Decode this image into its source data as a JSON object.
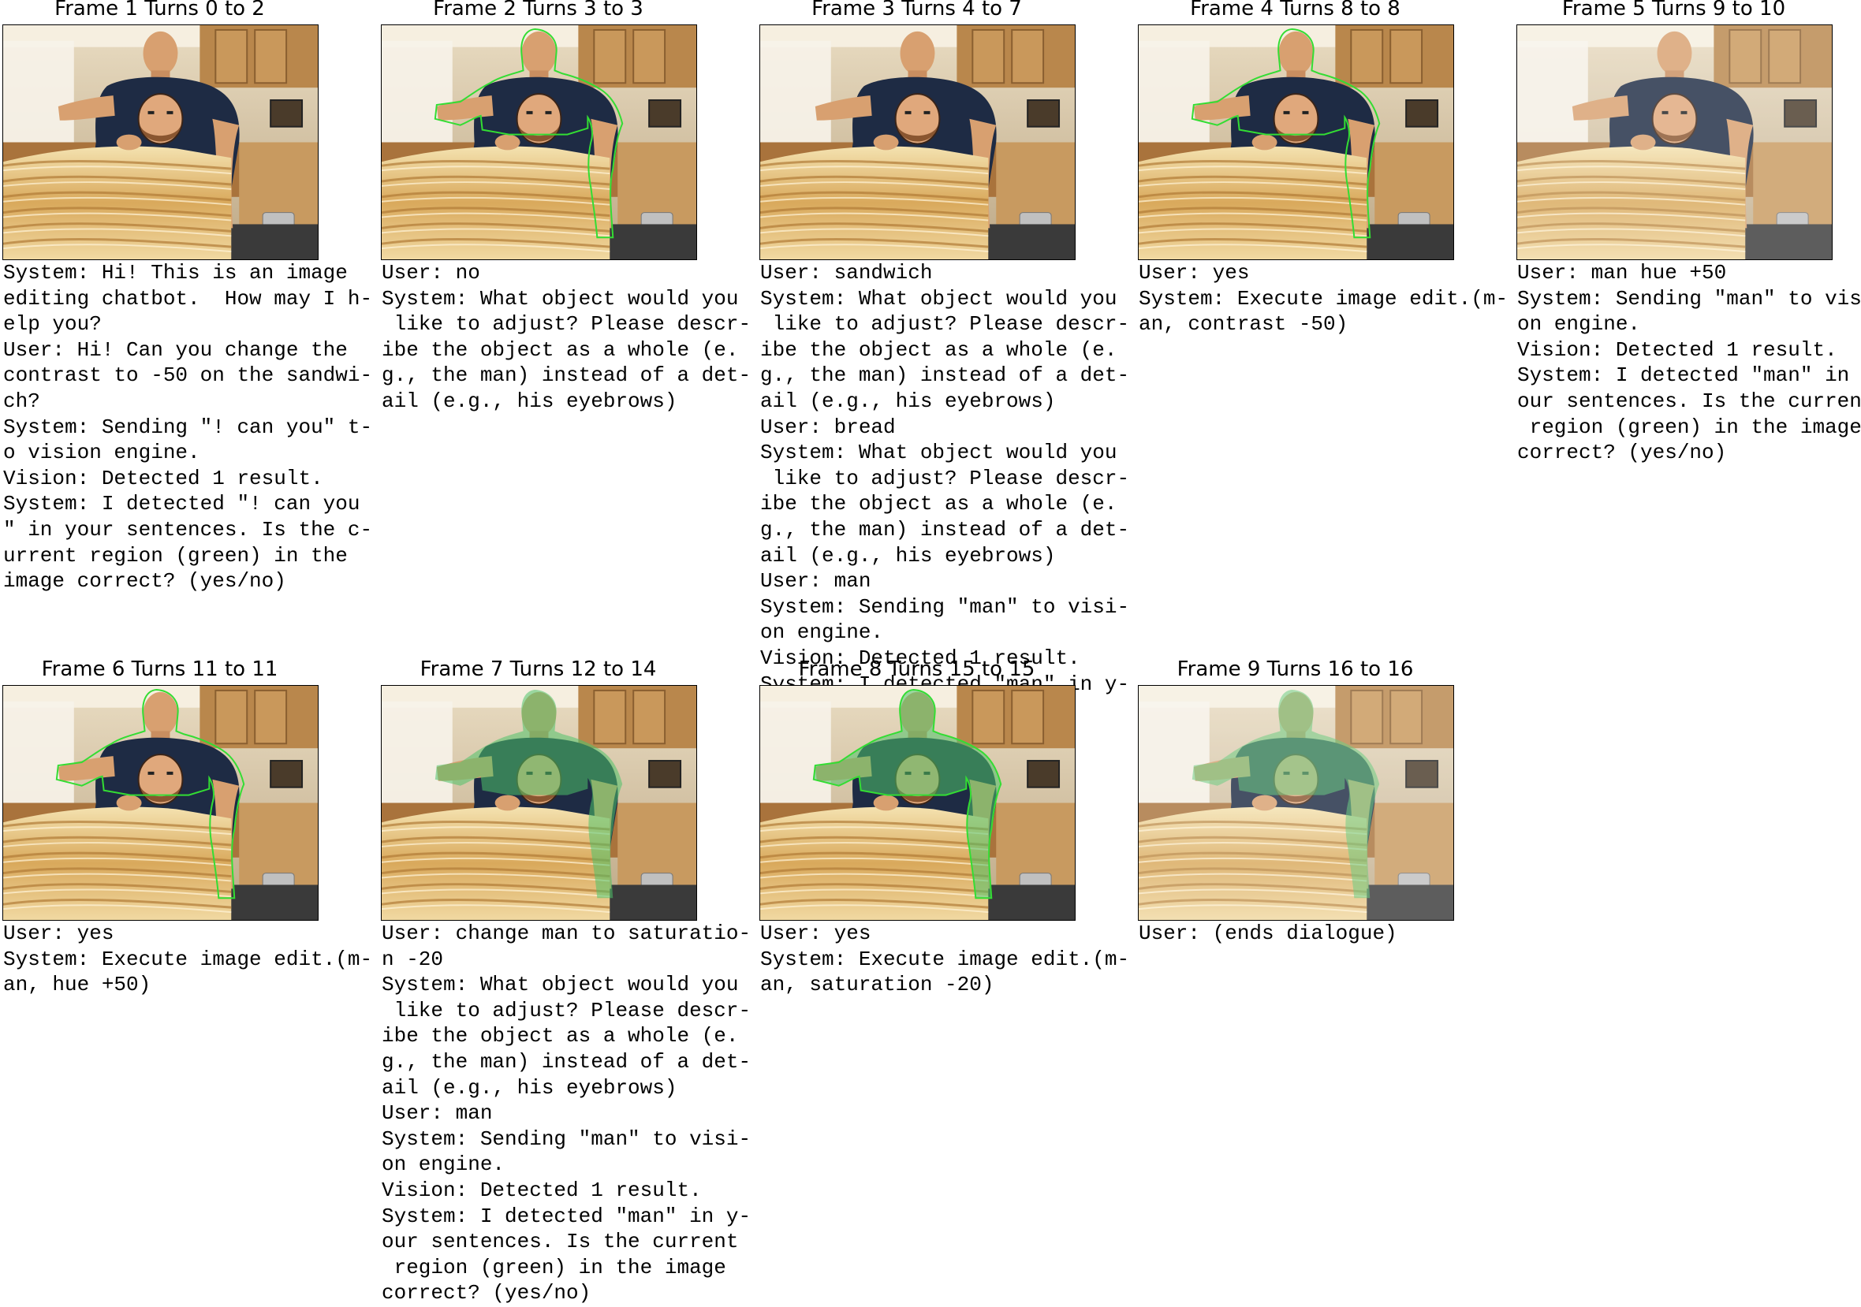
{
  "colors": {
    "region_outline": "#33dd33",
    "region_fill": "#4fc36a"
  },
  "frames": [
    {
      "title": "Frame 1 Turns 0 to 2",
      "image_alt": "kitchen-man-sandwich",
      "region": "none",
      "text": "System: Hi! This is an image\nediting chatbot.  How may I h-\nelp you?\nUser: Hi! Can you change the\ncontrast to -50 on the sandwi-\nch?\nSystem: Sending \"! can you\" t-\no vision engine.\nVision: Detected 1 result.\nSystem: I detected \"! can you\n\" in your sentences. Is the c-\nurrent region (green) in the\nimage correct? (yes/no)"
    },
    {
      "title": "Frame 2 Turns 3 to 3",
      "image_alt": "kitchen-man-sandwich",
      "region": "outline",
      "text": "User: no\nSystem: What object would you\n like to adjust? Please descr-\nibe the object as a whole (e.\ng., the man) instead of a det-\nail (e.g., his eyebrows)"
    },
    {
      "title": "Frame 3 Turns 4 to 7",
      "image_alt": "kitchen-man-sandwich",
      "region": "none",
      "text": "User: sandwich\nSystem: What object would you\n like to adjust? Please descr-\nibe the object as a whole (e.\ng., the man) instead of a det-\nail (e.g., his eyebrows)\nUser: bread\nSystem: What object would you\n like to adjust? Please descr-\nibe the object as a whole (e.\ng., the man) instead of a det-\nail (e.g., his eyebrows)\nUser: man\nSystem: Sending \"man\" to visi-\non engine.\nVision: Detected 1 result.\nSystem: I detected \"man\" in y-"
    },
    {
      "title": "Frame 4 Turns 8 to 8",
      "image_alt": "kitchen-man-sandwich",
      "region": "outline",
      "text": "User: yes\nSystem: Execute image edit.(m-\nan, contrast -50)"
    },
    {
      "title": "Frame 5 Turns 9 to 10",
      "image_alt": "kitchen-man-sandwich-low-contrast",
      "region": "none",
      "text": "User: man hue +50\nSystem: Sending \"man\" to visi-\non engine.\nVision: Detected 1 result.\nSystem: I detected \"man\" in y-\nour sentences. Is the current\n region (green) in the image\ncorrect? (yes/no)"
    },
    {
      "title": "Frame 6 Turns 11 to 11",
      "image_alt": "kitchen-man-sandwich",
      "region": "outline",
      "text": "User: yes\nSystem: Execute image edit.(m-\nan, hue +50)"
    },
    {
      "title": "Frame 7 Turns 12 to 14",
      "image_alt": "kitchen-man-sandwich-green-hue",
      "region": "tint",
      "text": "User: change man to saturatio-\nn -20\nSystem: What object would you\n like to adjust? Please descr-\nibe the object as a whole (e.\ng., the man) instead of a det-\nail (e.g., his eyebrows)\nUser: man\nSystem: Sending \"man\" to visi-\non engine.\nVision: Detected 1 result.\nSystem: I detected \"man\" in y-\nour sentences. Is the current\n region (green) in the image\ncorrect? (yes/no)"
    },
    {
      "title": "Frame 8 Turns 15 to 15",
      "image_alt": "kitchen-man-sandwich-green-hue",
      "region": "tint-outline",
      "text": "User: yes\nSystem: Execute image edit.(m-\nan, saturation -20)"
    },
    {
      "title": "Frame 9 Turns 16 to 16",
      "image_alt": "kitchen-man-sandwich-green-desaturated",
      "region": "tint",
      "text": "User: (ends dialogue)"
    }
  ]
}
